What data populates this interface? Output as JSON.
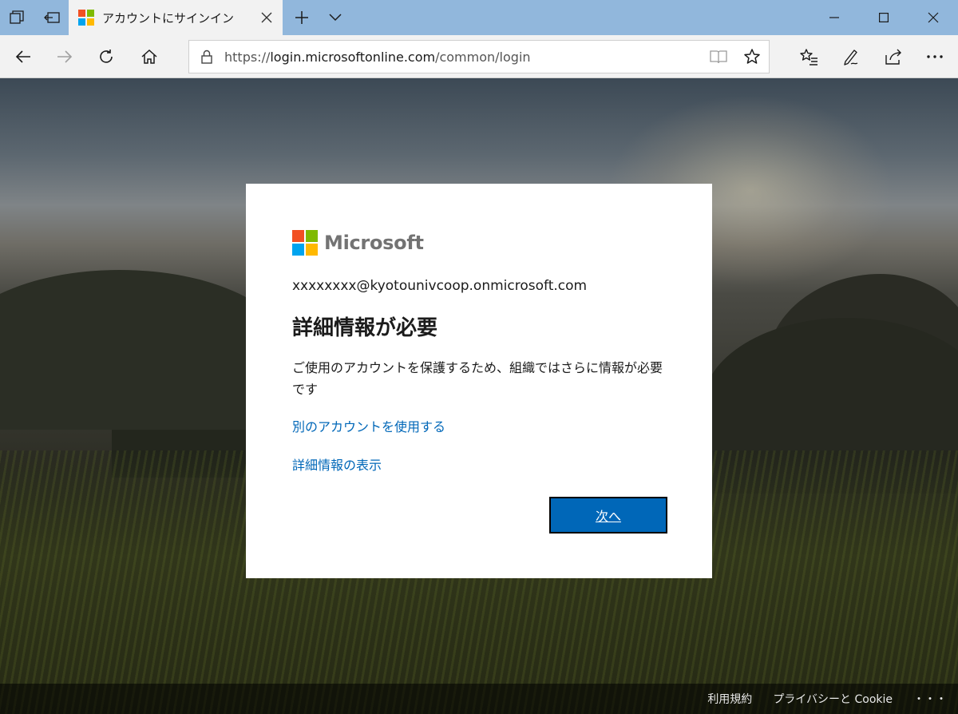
{
  "browser": {
    "tab_title": "アカウントにサインイン",
    "url_prefix": "https://",
    "url_host": "login.microsoftonline.com",
    "url_path": "/common/login"
  },
  "card": {
    "logo_text": "Microsoft",
    "email": "xxxxxxxx@kyotounivcoop.onmicrosoft.com",
    "heading": "詳細情報が必要",
    "description": "ご使用のアカウントを保護するため、組織ではさらに情報が必要です",
    "other_account_link": "別のアカウントを使用する",
    "more_info_link": "詳細情報の表示",
    "next_button": "次へ"
  },
  "footer": {
    "terms": "利用規約",
    "privacy": "プライバシーと Cookie",
    "more": "・・・"
  },
  "colors": {
    "ms_red": "#f25022",
    "ms_green": "#7fba00",
    "ms_blue": "#00a4ef",
    "ms_yellow": "#ffb900",
    "link": "#0067b8",
    "primary_button": "#0067b8",
    "tab_bar": "#91b7dc"
  }
}
